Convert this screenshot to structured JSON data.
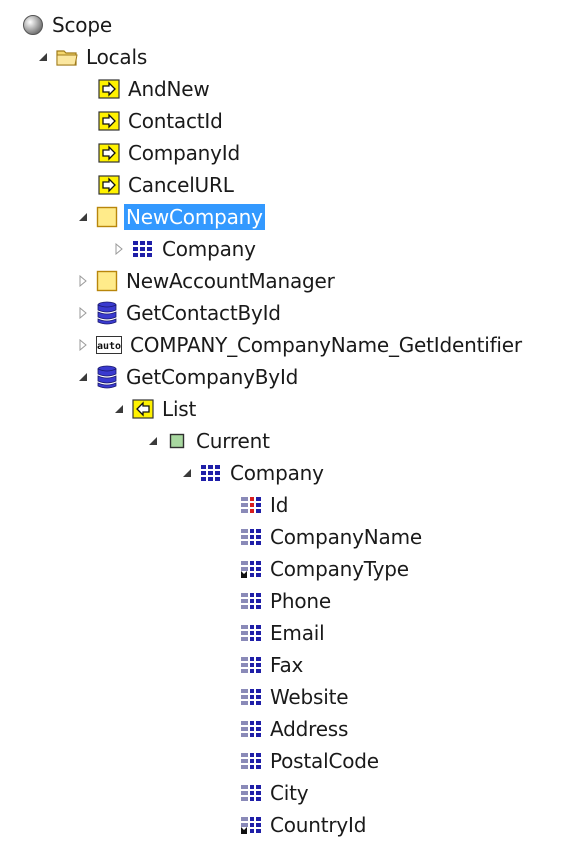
{
  "tree": {
    "root": "Scope",
    "locals": "Locals",
    "items": {
      "and_new": "AndNew",
      "contact_id": "ContactId",
      "company_id": "CompanyId",
      "cancel_url": "CancelURL",
      "new_company": "NewCompany",
      "company_record": "Company",
      "new_account_manager": "NewAccountManager",
      "get_contact_by_id": "GetContactById",
      "company_name_get_identifier": "COMPANY_CompanyName_GetIdentifier",
      "get_company_by_id": "GetCompanyById",
      "list": "List",
      "current": "Current",
      "company_entity": "Company"
    },
    "attributes": [
      "Id",
      "CompanyName",
      "CompanyType",
      "Phone",
      "Email",
      "Fax",
      "Website",
      "Address",
      "PostalCode",
      "City",
      "CountryId"
    ],
    "auto_badge": "auto",
    "selected": "NewCompany"
  },
  "colors": {
    "selection": "#3399ff",
    "entity_blue": "#1f1fa8",
    "folder_yellow": "#f5d76e",
    "param_yellow": "#fff200"
  }
}
